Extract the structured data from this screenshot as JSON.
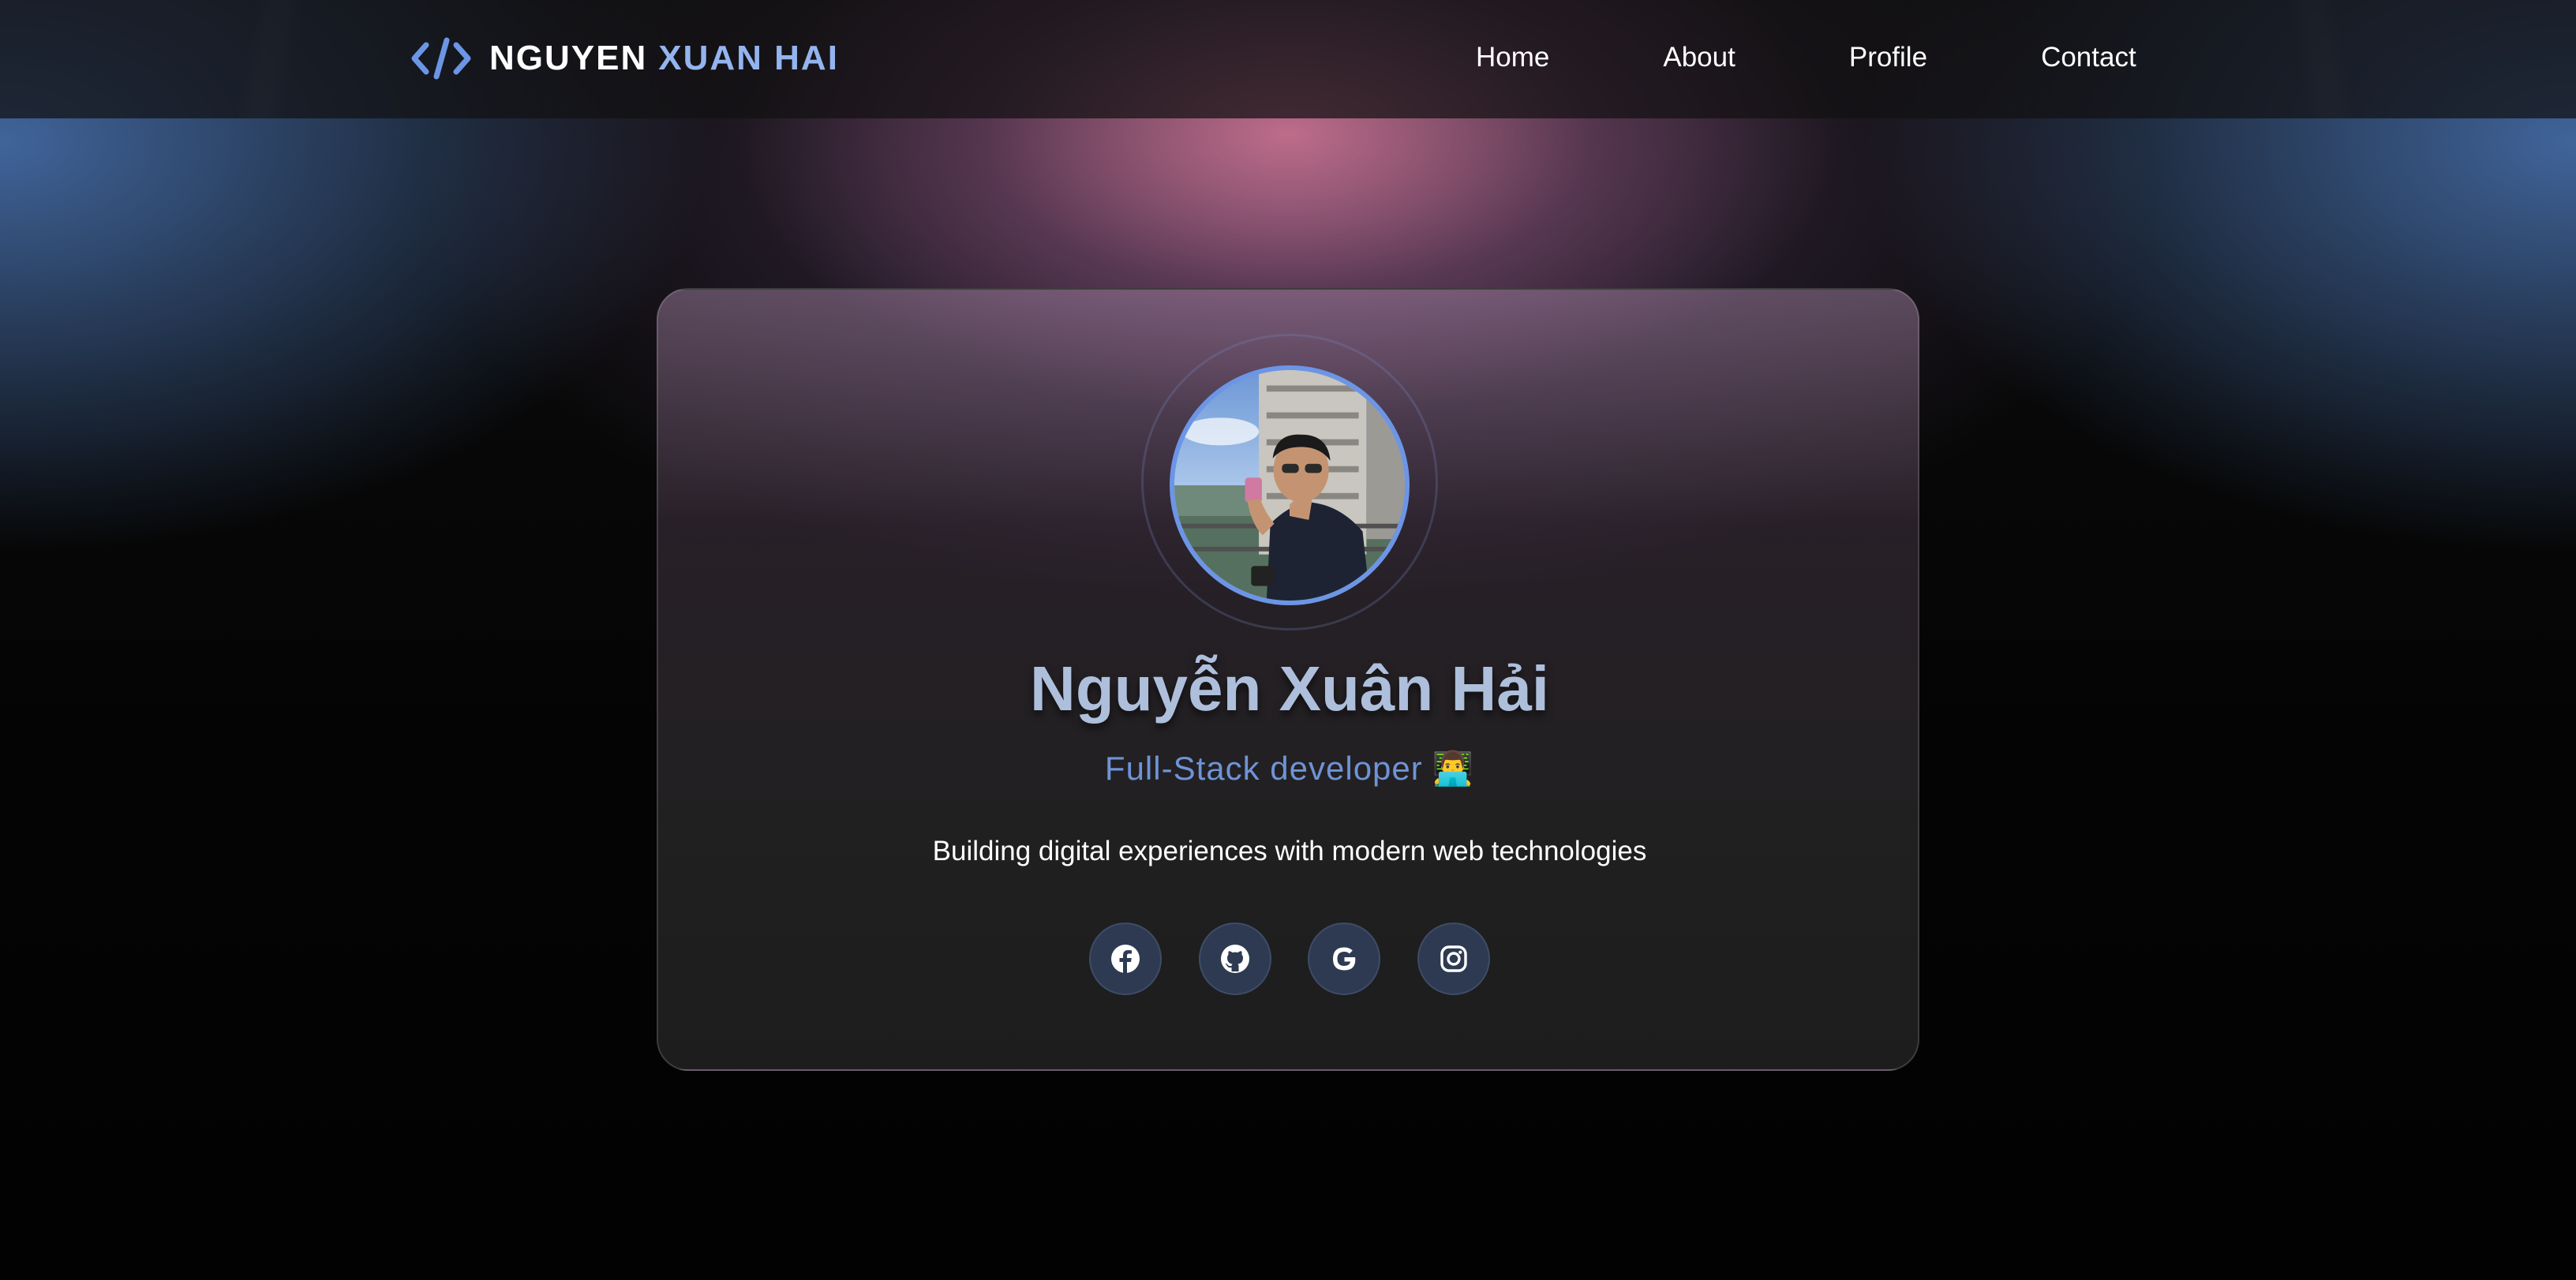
{
  "header": {
    "brand_first": "NGUYEN",
    "brand_last": "XUAN HAI",
    "brand_icon": "code-brackets-icon",
    "nav": [
      {
        "label": "Home"
      },
      {
        "label": "About"
      },
      {
        "label": "Profile"
      },
      {
        "label": "Contact"
      }
    ]
  },
  "profile": {
    "name": "Nguyễn Xuân Hải",
    "role": "Full-Stack developer",
    "role_emoji": "👨‍💻",
    "tagline": "Building digital experiences with modern web technologies",
    "socials": [
      {
        "icon": "facebook-icon"
      },
      {
        "icon": "github-icon"
      },
      {
        "icon": "google-icon"
      },
      {
        "icon": "instagram-icon"
      }
    ]
  },
  "colors": {
    "accent": "#6c95e6",
    "brand_accent": "#93b4ee",
    "social_bg": "#2d3a52",
    "page_bg": "#040404"
  }
}
